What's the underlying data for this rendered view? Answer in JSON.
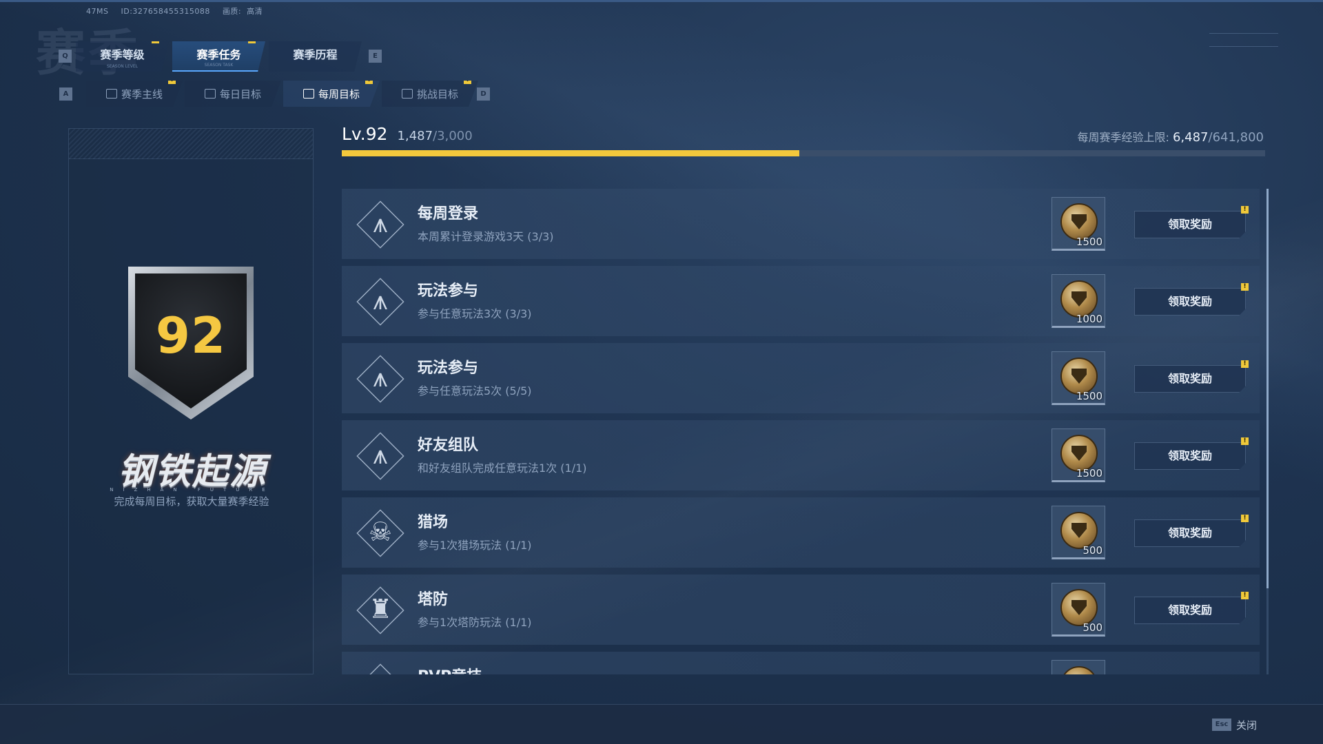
{
  "debug": {
    "ping": "47MS",
    "id": "ID:327658455315088",
    "quality_label": "画质:",
    "quality_value": "高清"
  },
  "watermark": "赛季",
  "keys": {
    "prev_tab": "Q",
    "next_tab": "E",
    "prev_sub": "A",
    "next_sub": "D",
    "close": "Esc"
  },
  "main_tabs": [
    {
      "label": "赛季等级",
      "sub": "SEASON LEVEL",
      "badge": "!",
      "active": false
    },
    {
      "label": "赛季任务",
      "sub": "SEASON TASK",
      "badge": "!",
      "active": true
    },
    {
      "label": "赛季历程",
      "sub": "",
      "badge": "",
      "active": false
    }
  ],
  "sub_tabs": [
    {
      "label": "赛季主线",
      "icon": "tree-icon",
      "badge": "!",
      "active": false
    },
    {
      "label": "每日目标",
      "icon": "calendar-icon",
      "badge": "",
      "active": false
    },
    {
      "label": "每周目标",
      "icon": "calendar-7-icon",
      "badge": "!",
      "active": true
    },
    {
      "label": "挑战目标",
      "icon": "flag-icon",
      "badge": "!",
      "active": false
    }
  ],
  "left_panel": {
    "level_number": "92",
    "game_logo": "钢铁起源",
    "logo_sub": "NIZHAN FUTURE",
    "description": "完成每周目标，获取大量赛季经验"
  },
  "level_bar": {
    "label": "Lv.92",
    "xp_current": "1,487",
    "xp_max": "/3,000",
    "progress_fraction": 0.4957,
    "weekly_cap_label": "每周赛季经验上限:",
    "weekly_cap_current": "6,487",
    "weekly_cap_max": "/641,800"
  },
  "quests": [
    {
      "title": "每周登录",
      "desc": "本周累计登录游戏3天 (3/3)",
      "icon": "wings-emblem-icon",
      "reward": "1500",
      "button": "领取奖励",
      "badge": "!"
    },
    {
      "title": "玩法参与",
      "desc": "参与任意玩法3次 (3/3)",
      "icon": "wings-emblem-icon",
      "reward": "1000",
      "button": "领取奖励",
      "badge": "!"
    },
    {
      "title": "玩法参与",
      "desc": "参与任意玩法5次 (5/5)",
      "icon": "wings-emblem-icon",
      "reward": "1500",
      "button": "领取奖励",
      "badge": "!"
    },
    {
      "title": "好友组队",
      "desc": "和好友组队完成任意玩法1次 (1/1)",
      "icon": "wings-emblem-icon",
      "reward": "1500",
      "button": "领取奖励",
      "badge": "!"
    },
    {
      "title": "猎场",
      "desc": "参与1次猎场玩法 (1/1)",
      "icon": "skull-emblem-icon",
      "reward": "500",
      "button": "领取奖励",
      "badge": "!"
    },
    {
      "title": "塔防",
      "desc": "参与1次塔防玩法 (1/1)",
      "icon": "tower-emblem-icon",
      "reward": "500",
      "button": "领取奖励",
      "badge": "!"
    },
    {
      "title": "PVP竞技",
      "desc": "",
      "icon": "wings-emblem-icon",
      "reward": "",
      "button": "",
      "badge": ""
    }
  ],
  "bottom": {
    "close_label": "关闭"
  },
  "colors": {
    "accent_yellow": "#f3c83c",
    "bg": "#1e3350",
    "tab_active_underline": "#5aa8ff"
  }
}
